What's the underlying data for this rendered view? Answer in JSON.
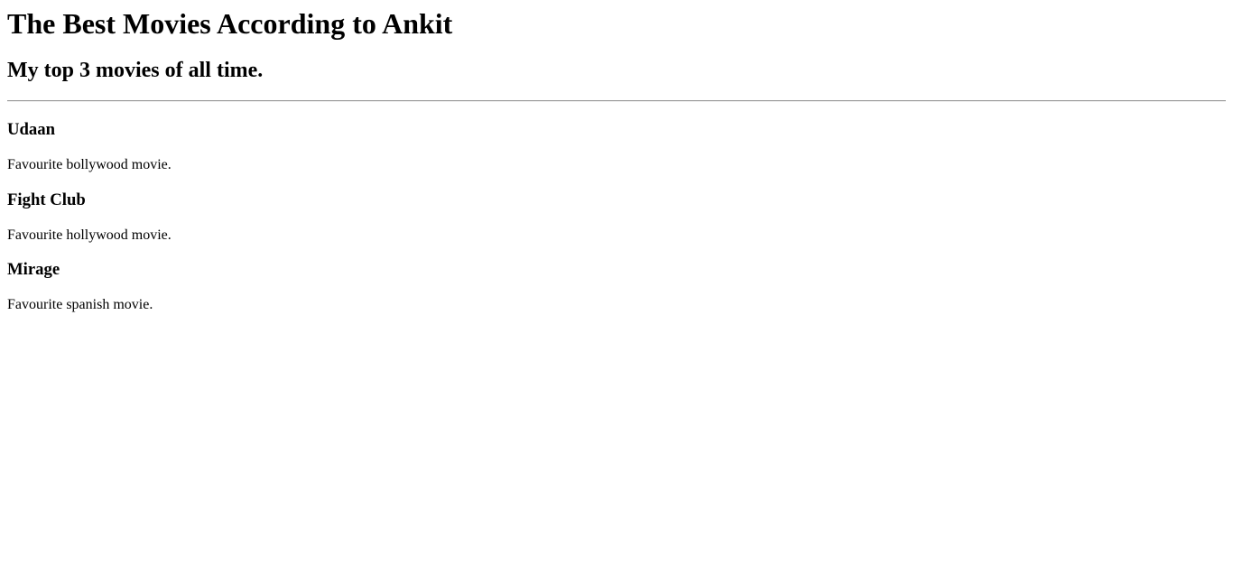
{
  "header": {
    "title": "The Best Movies According to Ankit",
    "subtitle": "My top 3 movies of all time."
  },
  "movies": [
    {
      "title": "Udaan",
      "description": "Favourite bollywood movie."
    },
    {
      "title": "Fight Club",
      "description": "Favourite hollywood movie."
    },
    {
      "title": "Mirage",
      "description": "Favourite spanish movie."
    }
  ]
}
